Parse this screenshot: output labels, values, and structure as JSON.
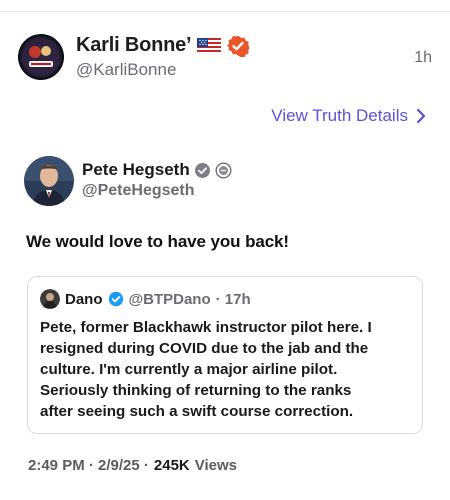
{
  "post": {
    "author_name": "Karli Bonne’",
    "author_handle": "@KarliBonne",
    "time": "1h",
    "flag_icon": "us-flag-icon",
    "verified_icon": "verified-badge-icon",
    "view_details_label": "View Truth Details"
  },
  "truth": {
    "author_name": "Pete Hegseth",
    "author_handle": "@PeteHegseth",
    "text": "We would love to have you back!",
    "timestamp": "2:49 PM · 2/9/25 ·",
    "views_count": "245K",
    "views_label": "Views"
  },
  "quote": {
    "name": "Dano",
    "handle": "@BTPDano",
    "time": "· 17h",
    "lines": [
      "Pete, former Blackhawk instructor pilot here. I",
      "resigned during COVID due to the jab and the",
      "culture. I'm currently a major airline pilot.",
      "Seriously thinking of returning to the ranks",
      "after seeing such a swift course correction."
    ]
  },
  "colors": {
    "accent": "#5c52d8",
    "verified_orange": "#e8562a",
    "verified_blue": "#1d9bf0",
    "muted": "#6b6b78"
  }
}
